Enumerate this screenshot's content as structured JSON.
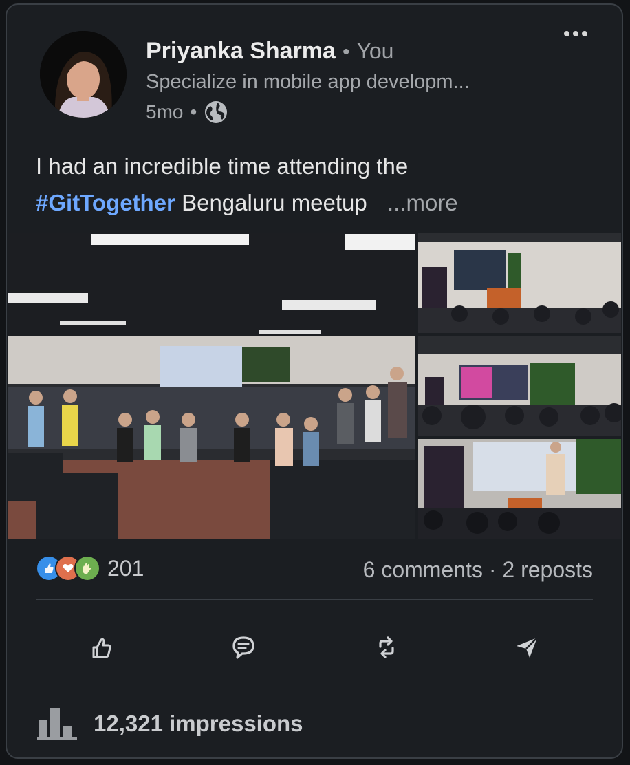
{
  "author": {
    "name": "Priyanka Sharma",
    "separator": "•",
    "relation": "You",
    "headline": "Specialize in mobile app developm...",
    "time": "5mo",
    "time_separator": "•",
    "visibility_icon": "globe-icon"
  },
  "post": {
    "text_before": "I had an incredible time attending the",
    "hashtag": "#GitTogether",
    "text_after": "Bengaluru meetup",
    "see_more": "...more"
  },
  "photos": [
    {
      "label": "group-photo",
      "accent": "#6a3d3a"
    },
    {
      "label": "presentation-photo-1",
      "accent": "#2f3d55"
    },
    {
      "label": "presentation-photo-2",
      "accent": "#3c4a5a"
    },
    {
      "label": "speaker-photo",
      "accent": "#2a3340"
    }
  ],
  "engagement": {
    "reaction_icons": [
      "like-icon",
      "love-icon",
      "celebrate-icon"
    ],
    "reaction_count": "201",
    "comments": "6 comments",
    "stats_separator": "·",
    "reposts": "2 reposts"
  },
  "actions": [
    "like-button",
    "comment-button",
    "repost-button",
    "send-button"
  ],
  "impressions": {
    "icon": "bar-chart-icon",
    "label": "12,321 impressions"
  },
  "colors": {
    "card_bg": "#1b1e22",
    "hashtag": "#6ea8ff",
    "like": "#378fe9",
    "love": "#df704d",
    "celebrate": "#6dae4f"
  }
}
